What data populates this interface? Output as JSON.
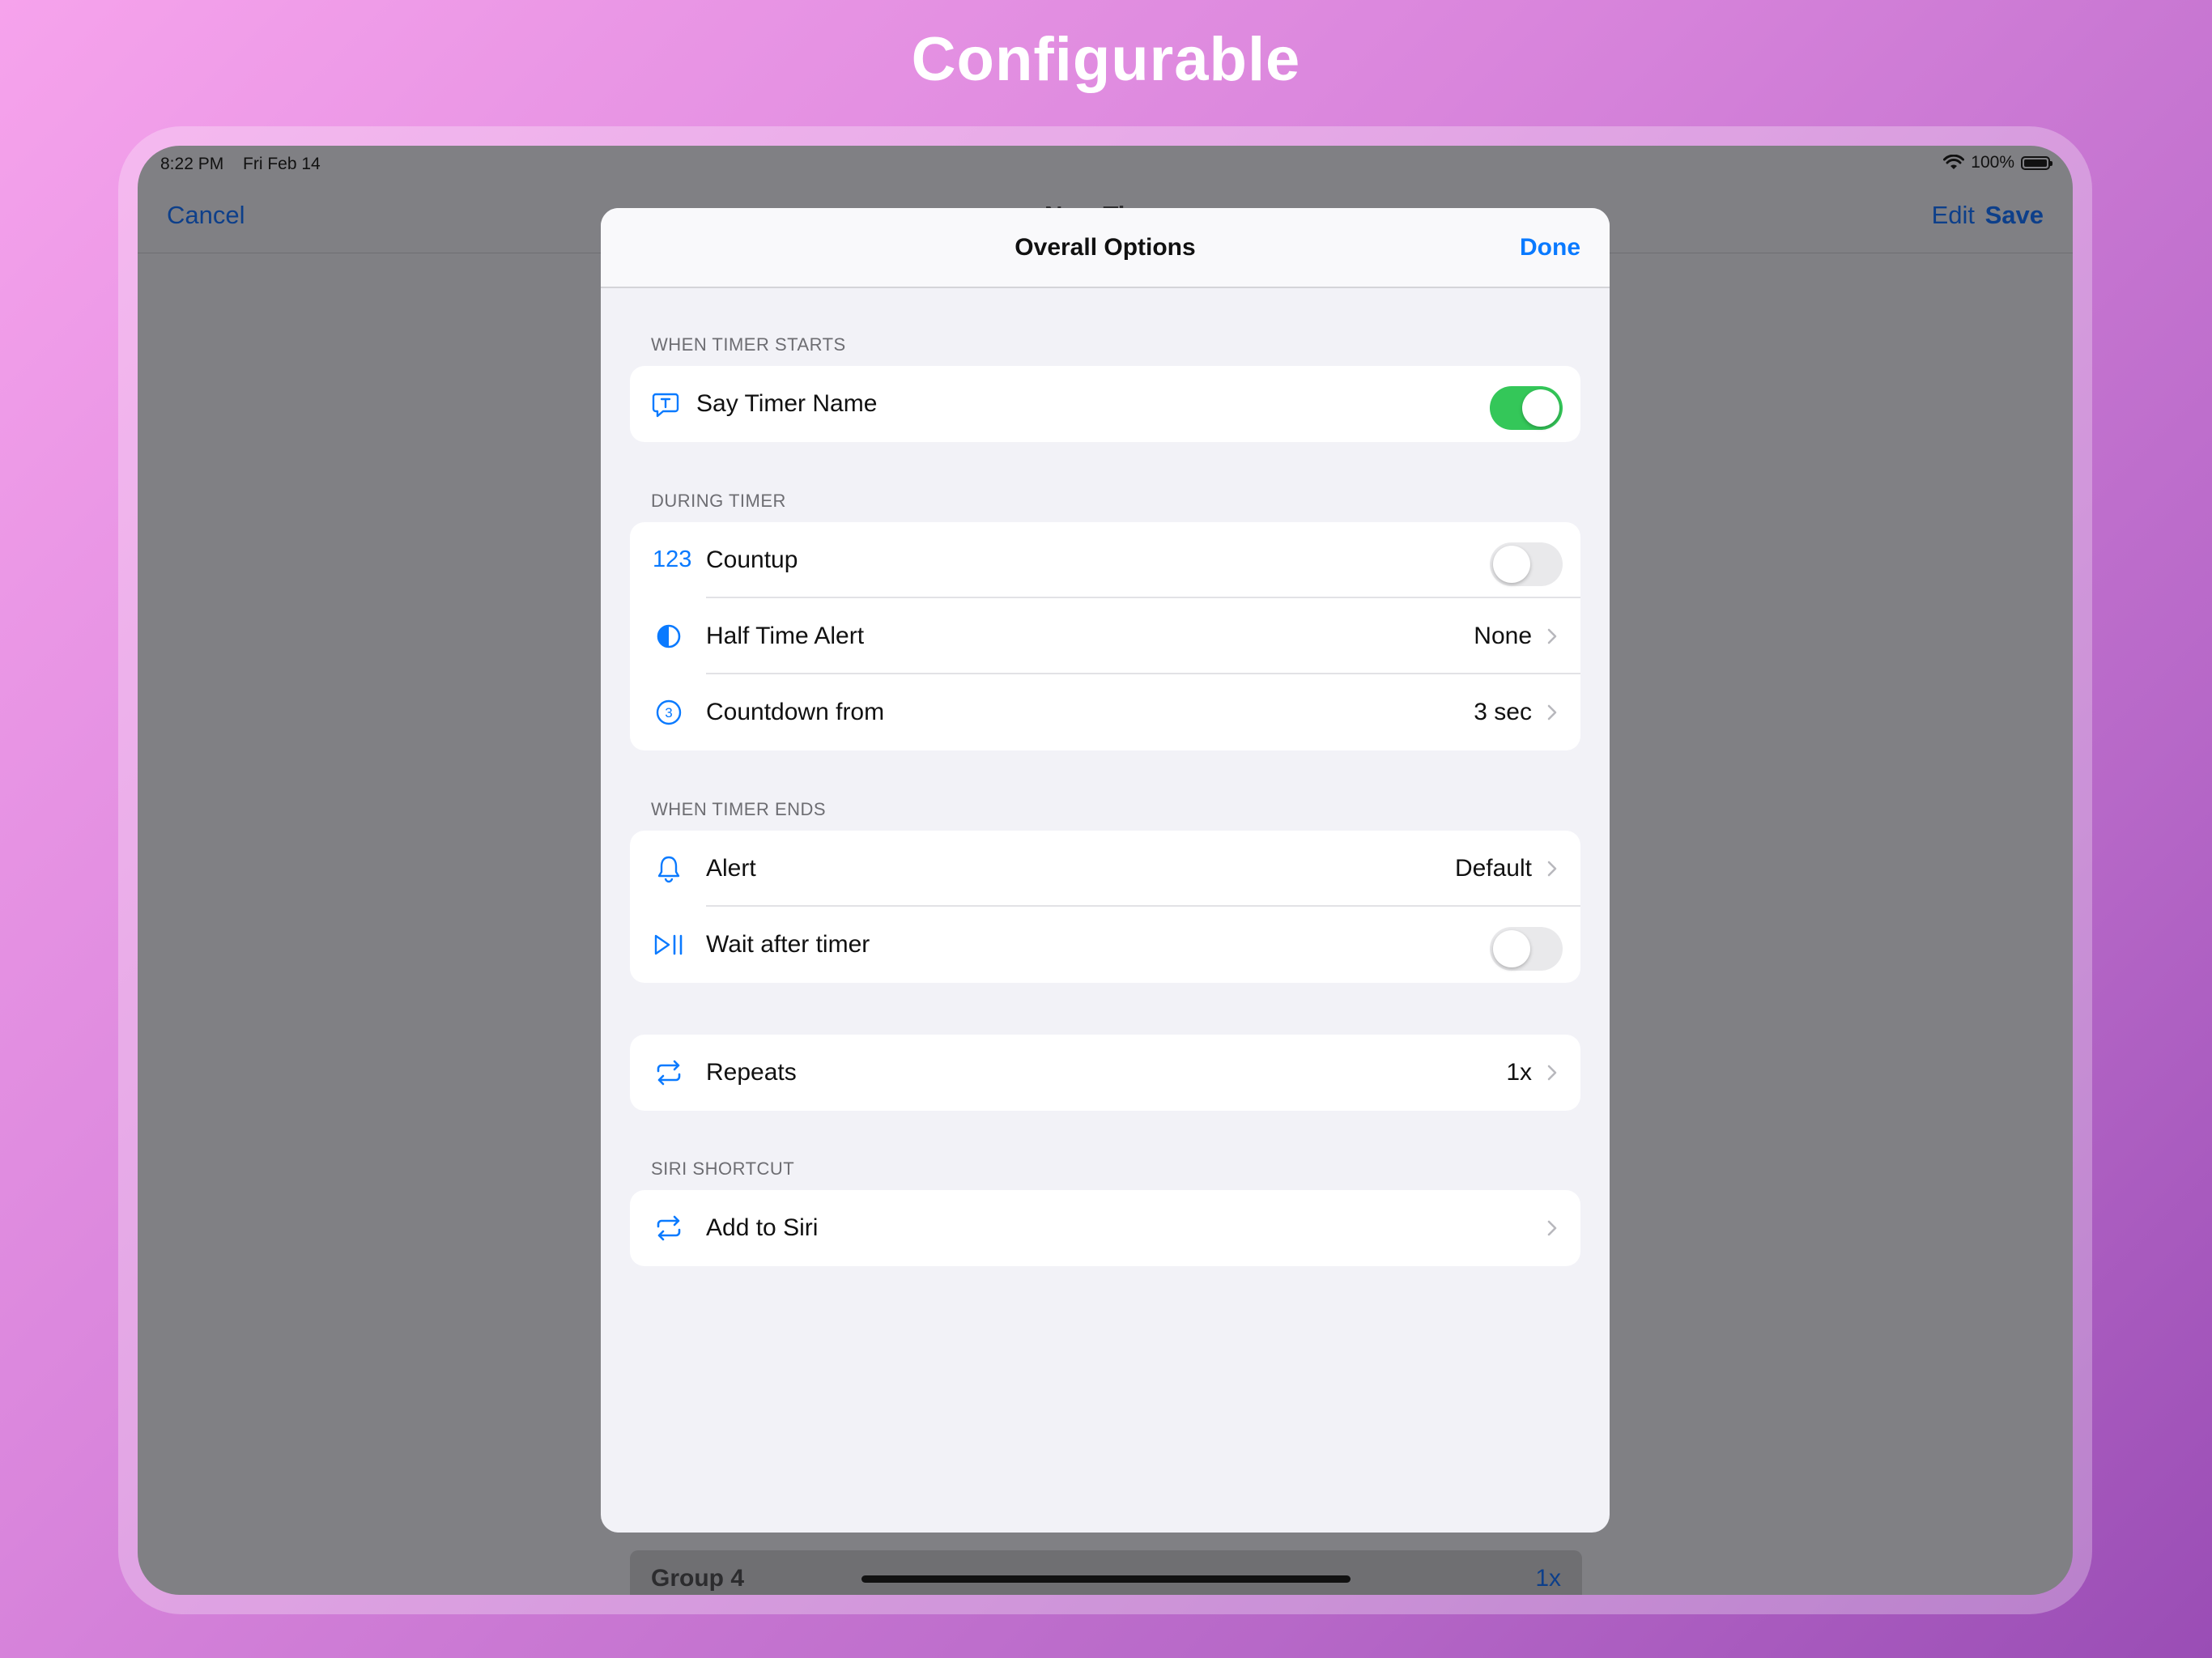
{
  "headline": "Configurable",
  "status_bar": {
    "time": "8:22 PM",
    "date": "Fri Feb 14",
    "battery": "100%",
    "icons": [
      "wifi-icon",
      "battery-icon"
    ]
  },
  "nav": {
    "cancel": "Cancel",
    "title": "New Timer",
    "edit": "Edit",
    "save": "Save"
  },
  "background_row": {
    "title": "Group 4",
    "value": "1x"
  },
  "sheet": {
    "title": "Overall Options",
    "done": "Done",
    "sections": {
      "start": {
        "header": "WHEN TIMER STARTS",
        "say_name": {
          "label": "Say Timer Name",
          "icon": "speech-bubble-icon",
          "on": true
        }
      },
      "during": {
        "header": "DURING TIMER",
        "countup": {
          "icon_text": "123",
          "label": "Countup",
          "on": false
        },
        "half_time": {
          "label": "Half Time Alert",
          "value": "None",
          "icon": "half-circle-icon"
        },
        "countdown": {
          "label": "Countdown from",
          "value": "3 sec",
          "icon": "circled-3-icon",
          "icon_digit": "3"
        }
      },
      "ends": {
        "header": "WHEN TIMER ENDS",
        "alert": {
          "label": "Alert",
          "value": "Default",
          "icon": "bell-icon"
        },
        "wait": {
          "label": "Wait after timer",
          "icon": "play-pause-icon",
          "on": false
        }
      },
      "repeats": {
        "row": {
          "label": "Repeats",
          "value": "1x",
          "icon": "repeat-icon"
        }
      },
      "siri": {
        "header": "SIRI SHORTCUT",
        "add": {
          "label": "Add to Siri",
          "icon": "repeat-icon"
        }
      }
    }
  },
  "colors": {
    "accent": "#0a7aff",
    "toggle_on": "#34c759",
    "toggle_off": "#e9e9eb",
    "sheet_bg": "#f2f2f7"
  }
}
